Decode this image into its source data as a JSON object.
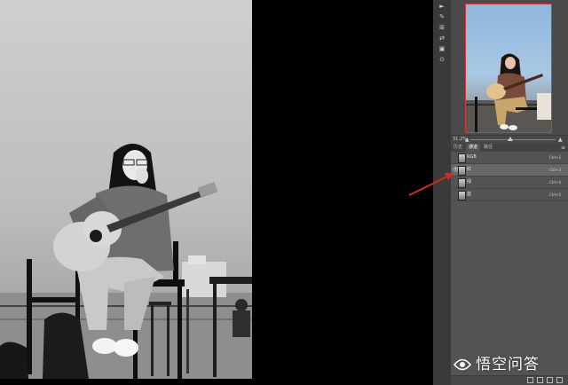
{
  "tools": [
    "►",
    "✎",
    "⊞",
    "⇄",
    "▣",
    "⊙"
  ],
  "navigator": {
    "zoom_level": "31.2%",
    "zoom_small": "▲",
    "zoom_large": "▲"
  },
  "panel_tabs": [
    "历史",
    "通道",
    "路径"
  ],
  "panel_menu": "≡",
  "channels": [
    {
      "name": "RGB",
      "shortcut": "Ctrl+2",
      "eye": "",
      "selected": false
    },
    {
      "name": "红",
      "shortcut": "Ctrl+3",
      "eye": "👁",
      "selected": true
    },
    {
      "name": "绿",
      "shortcut": "Ctrl+4",
      "eye": "",
      "selected": false
    },
    {
      "name": "蓝",
      "shortcut": "Ctrl+5",
      "eye": "",
      "selected": false
    }
  ],
  "watermark": {
    "text": "悟空问答"
  },
  "colors": {
    "arrow": "#d42a1e",
    "nav_border": "#d23b3b",
    "panel_bg": "#535353"
  }
}
